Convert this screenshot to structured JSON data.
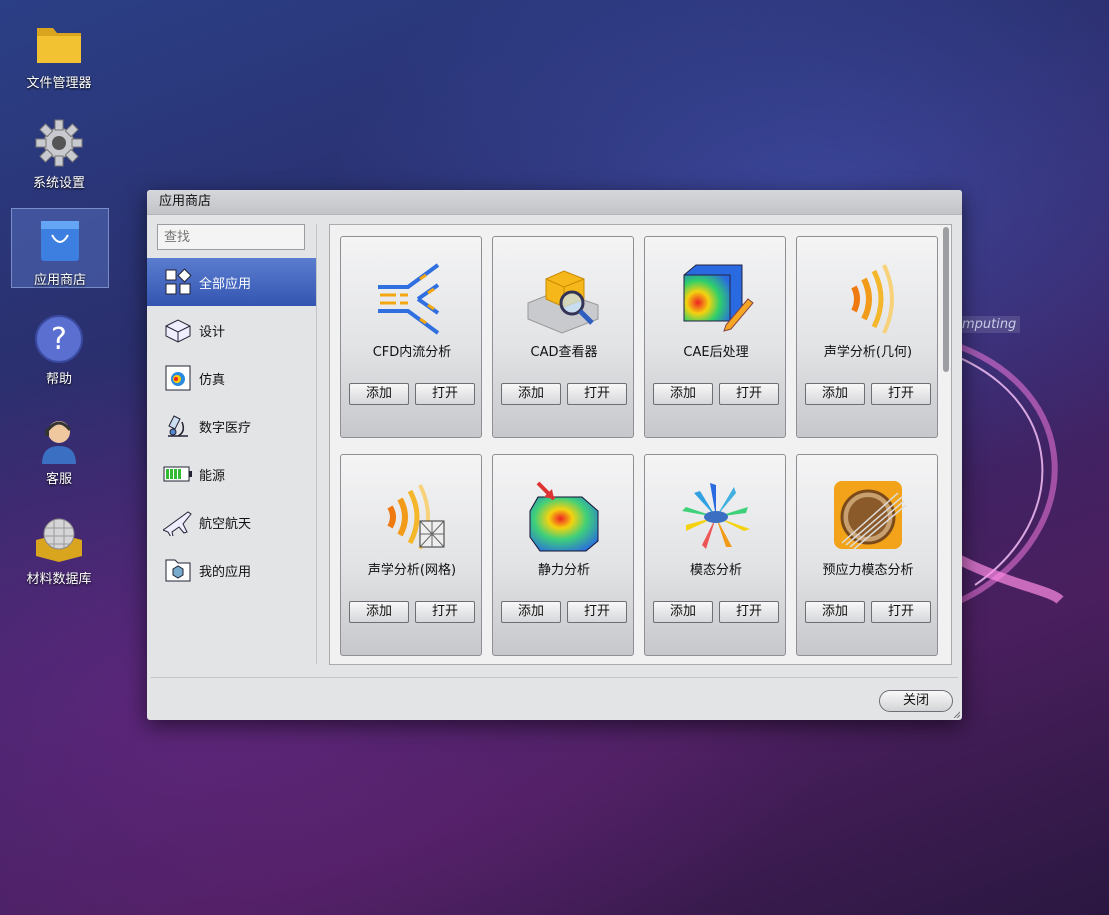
{
  "desktop": {
    "icons": [
      {
        "label": "文件管理器",
        "icon": "folder-icon"
      },
      {
        "label": "系统设置",
        "icon": "gear-icon"
      },
      {
        "label": "应用商店",
        "icon": "shopping-bag-icon"
      },
      {
        "label": "帮助",
        "icon": "help-icon"
      },
      {
        "label": "客服",
        "icon": "support-agent-icon"
      },
      {
        "label": "材料数据库",
        "icon": "materials-database-icon"
      }
    ],
    "background_tag": "omputing"
  },
  "window": {
    "title": "应用商店",
    "search": {
      "placeholder": "查找",
      "value": ""
    },
    "categories": [
      {
        "label": "全部应用",
        "icon": "grid-apps-icon",
        "active": true
      },
      {
        "label": "设计",
        "icon": "cube-design-icon"
      },
      {
        "label": "仿真",
        "icon": "simulation-icon"
      },
      {
        "label": "数字医疗",
        "icon": "microscope-icon"
      },
      {
        "label": "能源",
        "icon": "battery-icon"
      },
      {
        "label": "航空航天",
        "icon": "airplane-icon"
      },
      {
        "label": "我的应用",
        "icon": "my-apps-folder-icon"
      }
    ],
    "apps": [
      {
        "name": "CFD内流分析",
        "icon": "cfd-flow-icon"
      },
      {
        "name": "CAD查看器",
        "icon": "cad-viewer-icon"
      },
      {
        "name": "CAE后处理",
        "icon": "cae-postprocess-icon"
      },
      {
        "name": "声学分析(几何)",
        "icon": "acoustic-geometry-icon"
      },
      {
        "name": "声学分析(网格)",
        "icon": "acoustic-mesh-icon"
      },
      {
        "name": "静力分析",
        "icon": "static-analysis-icon"
      },
      {
        "name": "模态分析",
        "icon": "modal-analysis-icon"
      },
      {
        "name": "预应力模态分析",
        "icon": "prestress-modal-icon"
      }
    ],
    "add_label": "添加",
    "open_label": "打开",
    "close_label": "关闭"
  },
  "colors": {
    "accent": "#3d5fbf",
    "window_bg": "#e3e4e6"
  }
}
